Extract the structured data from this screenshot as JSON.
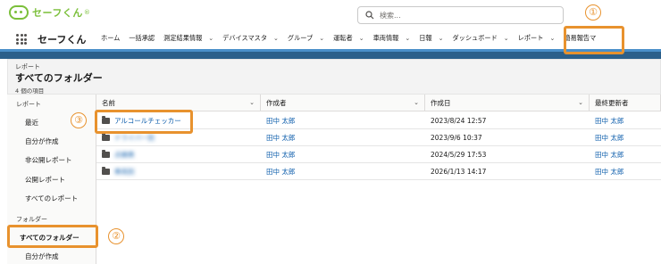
{
  "header": {
    "brand": "セーフくん",
    "brand_sub": "®",
    "search_placeholder": "検索..."
  },
  "nav": {
    "app_name": "セーフくん",
    "items": [
      {
        "label": "ホーム",
        "chevron": false
      },
      {
        "label": "一括承認",
        "chevron": false
      },
      {
        "label": "測定結果情報",
        "chevron": true
      },
      {
        "label": "デバイスマスタ",
        "chevron": true
      },
      {
        "label": "グループ",
        "chevron": true
      },
      {
        "label": "運転者",
        "chevron": true
      },
      {
        "label": "車両情報",
        "chevron": true
      },
      {
        "label": "日報",
        "chevron": true
      },
      {
        "label": "ダッシュボード",
        "chevron": true
      },
      {
        "label": "レポート",
        "chevron": true
      },
      {
        "label": "簡易報告マ",
        "chevron": false
      }
    ]
  },
  "page": {
    "category": "レポート",
    "title": "すべてのフォルダー",
    "count": "4 個の項目"
  },
  "sidebar": {
    "section_reports": "レポート",
    "report_items": [
      "最近",
      "自分が作成",
      "非公開レポート",
      "公開レポート",
      "すべてのレポート"
    ],
    "section_folders": "フォルダー",
    "folder_items": [
      "すべてのフォルダー",
      "自分が作成"
    ]
  },
  "table": {
    "columns": [
      "名前",
      "作成者",
      "作成日",
      "最終更新者"
    ],
    "rows": [
      {
        "name": "アルコールチェッカー",
        "creator": "田中 太郎",
        "created": "2023/8/24 12:57",
        "modifier": "田中 太郎",
        "blurred": false
      },
      {
        "name": "ドライバー別",
        "creator": "田中 太郎",
        "created": "2023/9/6 10:37",
        "modifier": "田中 太郎",
        "blurred": true
      },
      {
        "name": "点検表",
        "creator": "田中 太郎",
        "created": "2024/5/29 17:53",
        "modifier": "田中 太郎",
        "blurred": true
      },
      {
        "name": "車両別",
        "creator": "田中 太郎",
        "created": "2026/1/13 14:17",
        "modifier": "田中 太郎",
        "blurred": true
      }
    ]
  },
  "annotations": {
    "num1": "①",
    "num2": "②",
    "num3": "③",
    "color": "#e8922e"
  }
}
